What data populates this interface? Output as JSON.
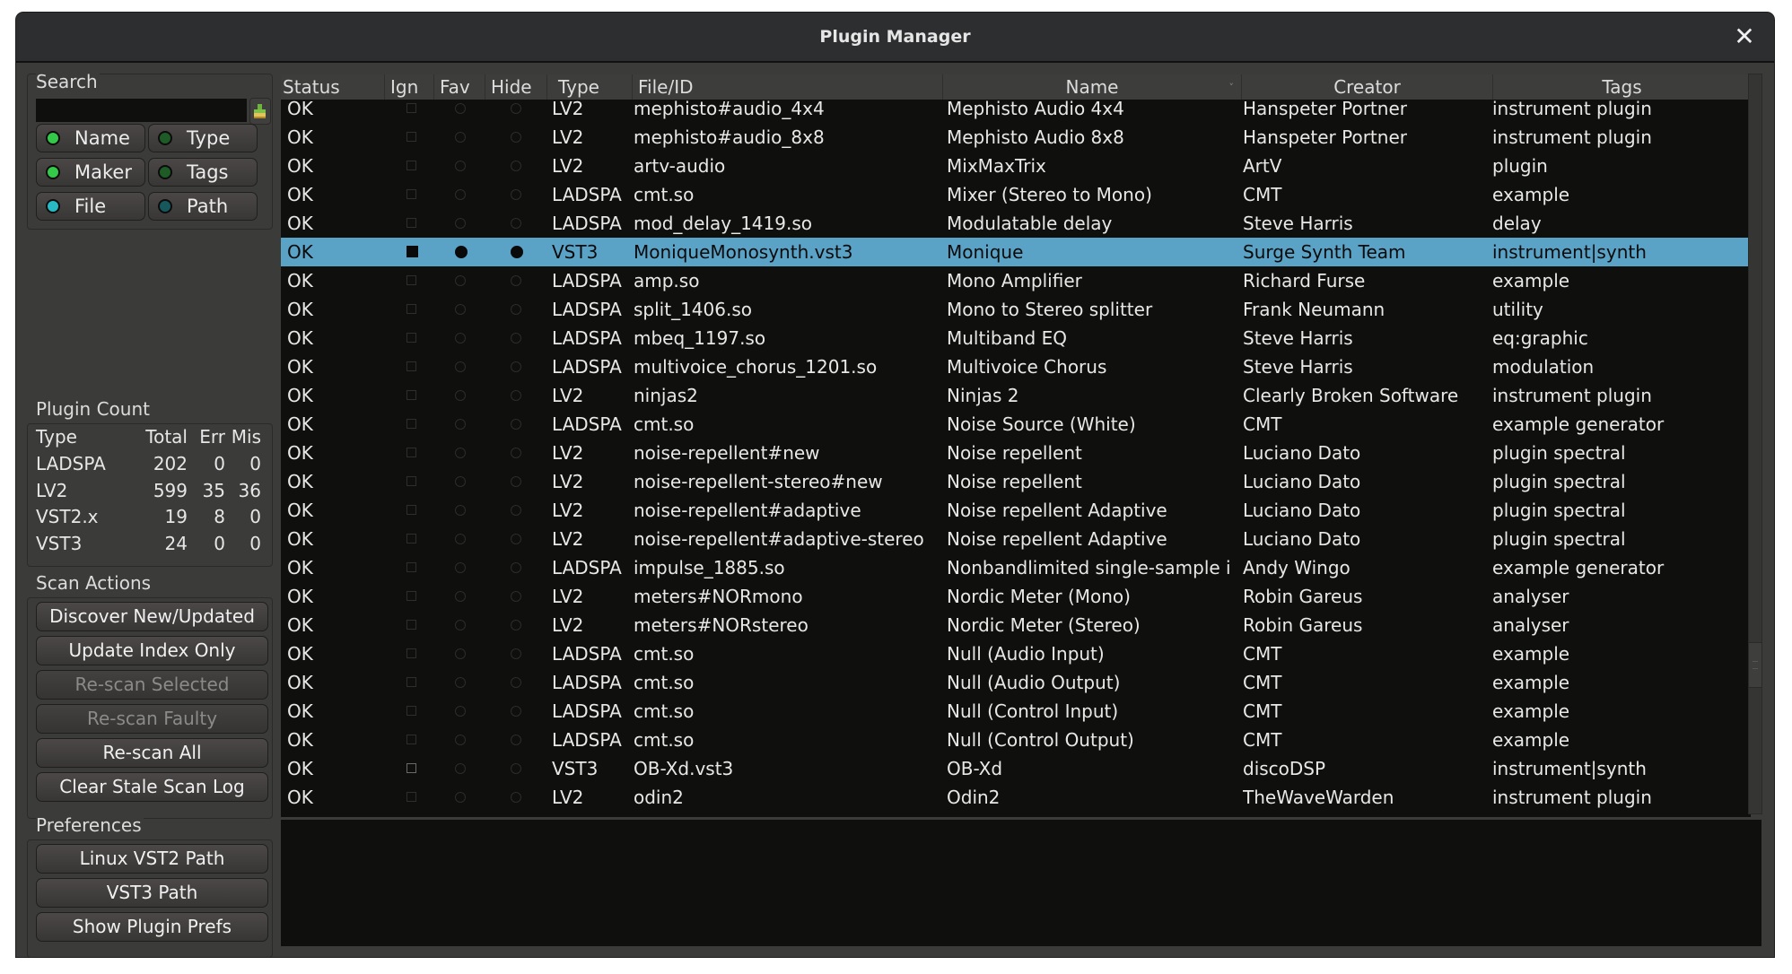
{
  "window": {
    "title": "Plugin Manager",
    "close_icon": "close-icon"
  },
  "search": {
    "label": "Search",
    "value": "",
    "placeholder": "",
    "clear_icon": "brush-clear-icon",
    "toggles": [
      {
        "label": "Name",
        "on": true,
        "color": "#35c94a"
      },
      {
        "label": "Type",
        "on": false,
        "color": "#1e5b27"
      },
      {
        "label": "Maker",
        "on": true,
        "color": "#35c94a"
      },
      {
        "label": "Tags",
        "on": false,
        "color": "#1e5b27"
      },
      {
        "label": "File",
        "on": true,
        "color": "#27b9c4"
      },
      {
        "label": "Path",
        "on": false,
        "color": "#16585c"
      }
    ]
  },
  "plugin_count": {
    "label": "Plugin Count",
    "headers": {
      "type": "Type",
      "total": "Total",
      "err": "Err",
      "mis": "Mis"
    },
    "rows": [
      {
        "type": "LADSPA",
        "total": "202",
        "err": "0",
        "mis": "0"
      },
      {
        "type": "LV2",
        "total": "599",
        "err": "35",
        "mis": "36"
      },
      {
        "type": "VST2.x",
        "total": "19",
        "err": "8",
        "mis": "0"
      },
      {
        "type": "VST3",
        "total": "24",
        "err": "0",
        "mis": "0"
      }
    ]
  },
  "scan_actions": {
    "label": "Scan Actions",
    "buttons": [
      {
        "label": "Discover New/Updated",
        "enabled": true
      },
      {
        "label": "Update Index Only",
        "enabled": true
      },
      {
        "label": "Re-scan Selected",
        "enabled": false
      },
      {
        "label": "Re-scan Faulty",
        "enabled": false
      },
      {
        "label": "Re-scan All",
        "enabled": true
      },
      {
        "label": "Clear Stale Scan Log",
        "enabled": true
      }
    ]
  },
  "preferences": {
    "label": "Preferences",
    "buttons": [
      {
        "label": "Linux VST2 Path"
      },
      {
        "label": "VST3 Path"
      },
      {
        "label": "Show Plugin Prefs"
      }
    ]
  },
  "table": {
    "columns": [
      "Status",
      "Ign",
      "Fav",
      "Hide",
      "Type",
      "File/ID",
      "Name",
      "Creator",
      "Tags"
    ],
    "sort_column": "Name",
    "sort_icon": "sort-descending-icon",
    "selected_index": 5,
    "scroll_position_fraction": 0.78,
    "rows": [
      {
        "status": "OK",
        "ign": false,
        "fav": false,
        "hide": false,
        "type": "LV2",
        "file": "mephisto#audio_4x4",
        "name": "Mephisto Audio 4x4",
        "creator": "Hanspeter Portner",
        "tags": "instrument plugin"
      },
      {
        "status": "OK",
        "ign": false,
        "fav": false,
        "hide": false,
        "type": "LV2",
        "file": "mephisto#audio_8x8",
        "name": "Mephisto Audio 8x8",
        "creator": "Hanspeter Portner",
        "tags": "instrument plugin"
      },
      {
        "status": "OK",
        "ign": false,
        "fav": false,
        "hide": false,
        "type": "LV2",
        "file": "artv-audio",
        "name": "MixMaxTrix",
        "creator": "ArtV",
        "tags": "plugin"
      },
      {
        "status": "OK",
        "ign": false,
        "fav": false,
        "hide": false,
        "type": "LADSPA",
        "file": "cmt.so",
        "name": "Mixer (Stereo to Mono)",
        "creator": "CMT",
        "tags": "example"
      },
      {
        "status": "OK",
        "ign": false,
        "fav": false,
        "hide": false,
        "type": "LADSPA",
        "file": "mod_delay_1419.so",
        "name": "Modulatable delay",
        "creator": "Steve Harris",
        "tags": "delay"
      },
      {
        "status": "OK",
        "ign": true,
        "fav": true,
        "hide": true,
        "type": "VST3",
        "file": "MoniqueMonosynth.vst3",
        "name": "Monique",
        "creator": "Surge Synth Team",
        "tags": "instrument|synth"
      },
      {
        "status": "OK",
        "ign": false,
        "fav": false,
        "hide": false,
        "type": "LADSPA",
        "file": "amp.so",
        "name": "Mono Amplifier",
        "creator": "Richard Furse",
        "tags": "example"
      },
      {
        "status": "OK",
        "ign": false,
        "fav": false,
        "hide": false,
        "type": "LADSPA",
        "file": "split_1406.so",
        "name": "Mono to Stereo splitter",
        "creator": "Frank Neumann",
        "tags": "utility"
      },
      {
        "status": "OK",
        "ign": false,
        "fav": false,
        "hide": false,
        "type": "LADSPA",
        "file": "mbeq_1197.so",
        "name": "Multiband EQ",
        "creator": "Steve Harris",
        "tags": "eq:graphic"
      },
      {
        "status": "OK",
        "ign": false,
        "fav": false,
        "hide": false,
        "type": "LADSPA",
        "file": "multivoice_chorus_1201.so",
        "name": "Multivoice Chorus",
        "creator": "Steve Harris",
        "tags": "modulation"
      },
      {
        "status": "OK",
        "ign": false,
        "fav": false,
        "hide": false,
        "type": "LV2",
        "file": "ninjas2",
        "name": "Ninjas 2",
        "creator": "Clearly Broken Software",
        "tags": "instrument plugin"
      },
      {
        "status": "OK",
        "ign": false,
        "fav": false,
        "hide": false,
        "type": "LADSPA",
        "file": "cmt.so",
        "name": "Noise Source (White)",
        "creator": "CMT",
        "tags": "example generator"
      },
      {
        "status": "OK",
        "ign": false,
        "fav": false,
        "hide": false,
        "type": "LV2",
        "file": "noise-repellent#new",
        "name": "Noise repellent",
        "creator": "Luciano Dato",
        "tags": "plugin spectral"
      },
      {
        "status": "OK",
        "ign": false,
        "fav": false,
        "hide": false,
        "type": "LV2",
        "file": "noise-repellent-stereo#new",
        "name": "Noise repellent",
        "creator": "Luciano Dato",
        "tags": "plugin spectral"
      },
      {
        "status": "OK",
        "ign": false,
        "fav": false,
        "hide": false,
        "type": "LV2",
        "file": "noise-repellent#adaptive",
        "name": "Noise repellent Adaptive",
        "creator": "Luciano Dato",
        "tags": "plugin spectral"
      },
      {
        "status": "OK",
        "ign": false,
        "fav": false,
        "hide": false,
        "type": "LV2",
        "file": "noise-repellent#adaptive-stereo",
        "name": "Noise repellent Adaptive",
        "creator": "Luciano Dato",
        "tags": "plugin spectral"
      },
      {
        "status": "OK",
        "ign": false,
        "fav": false,
        "hide": false,
        "type": "LADSPA",
        "file": "impulse_1885.so",
        "name": "Nonbandlimited single-sample i",
        "creator": "Andy Wingo",
        "tags": "example generator"
      },
      {
        "status": "OK",
        "ign": false,
        "fav": false,
        "hide": false,
        "type": "LV2",
        "file": "meters#NORmono",
        "name": "Nordic Meter (Mono)",
        "creator": "Robin Gareus",
        "tags": "analyser"
      },
      {
        "status": "OK",
        "ign": false,
        "fav": false,
        "hide": false,
        "type": "LV2",
        "file": "meters#NORstereo",
        "name": "Nordic Meter (Stereo)",
        "creator": "Robin Gareus",
        "tags": "analyser"
      },
      {
        "status": "OK",
        "ign": false,
        "fav": false,
        "hide": false,
        "type": "LADSPA",
        "file": "cmt.so",
        "name": "Null (Audio Input)",
        "creator": "CMT",
        "tags": "example"
      },
      {
        "status": "OK",
        "ign": false,
        "fav": false,
        "hide": false,
        "type": "LADSPA",
        "file": "cmt.so",
        "name": "Null (Audio Output)",
        "creator": "CMT",
        "tags": "example"
      },
      {
        "status": "OK",
        "ign": false,
        "fav": false,
        "hide": false,
        "type": "LADSPA",
        "file": "cmt.so",
        "name": "Null (Control Input)",
        "creator": "CMT",
        "tags": "example"
      },
      {
        "status": "OK",
        "ign": false,
        "fav": false,
        "hide": false,
        "type": "LADSPA",
        "file": "cmt.so",
        "name": "Null (Control Output)",
        "creator": "CMT",
        "tags": "example"
      },
      {
        "status": "OK",
        "ign": false,
        "fav": false,
        "hide": false,
        "type": "VST3",
        "file": "OB-Xd.vst3",
        "name": "OB-Xd",
        "creator": "discoDSP",
        "tags": "instrument|synth",
        "ign_highlight": true
      },
      {
        "status": "OK",
        "ign": false,
        "fav": false,
        "hide": false,
        "type": "LV2",
        "file": "odin2",
        "name": "Odin2",
        "creator": "TheWaveWarden",
        "tags": "instrument plugin"
      }
    ]
  },
  "log": {
    "text": ""
  },
  "colors": {
    "selection": "#5aa3c6",
    "table_bg": "#0f100e",
    "panel_bg": "#3b3c39",
    "titlebar_bg": "#2c2e30"
  }
}
